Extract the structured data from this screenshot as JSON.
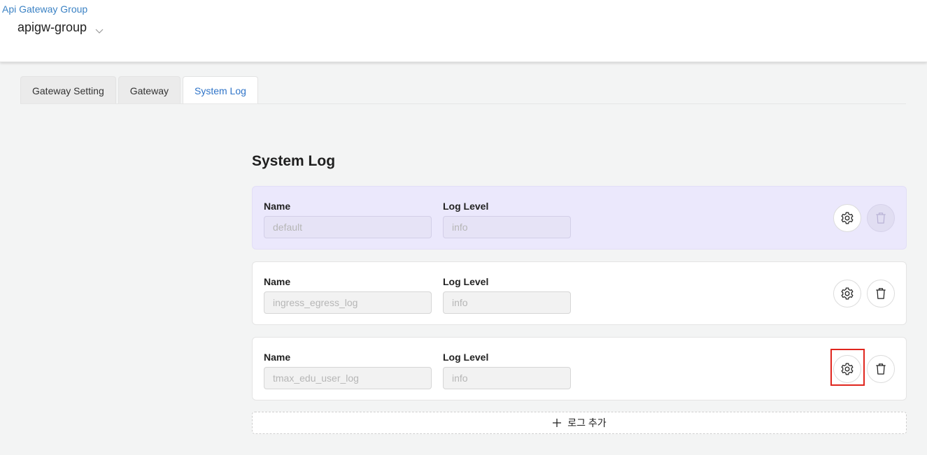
{
  "header": {
    "breadcrumb": "Api Gateway Group",
    "group_name": "apigw-group"
  },
  "tabs": [
    {
      "label": "Gateway Setting",
      "active": false
    },
    {
      "label": "Gateway",
      "active": false
    },
    {
      "label": "System Log",
      "active": true
    }
  ],
  "section": {
    "title": "System Log",
    "name_label": "Name",
    "level_label": "Log Level"
  },
  "logs": [
    {
      "name": "default",
      "level": "info",
      "delete_disabled": true
    },
    {
      "name": "ingress_egress_log",
      "level": "info",
      "delete_disabled": false
    },
    {
      "name": "tmax_edu_user_log",
      "level": "info",
      "delete_disabled": false
    }
  ],
  "add_button": {
    "label": "로그 추가"
  },
  "colors": {
    "accent": "#2f74c8",
    "link": "#3b82c4",
    "highlight_card": "#ebe8fc",
    "focus_outline": "#e0261e"
  },
  "icons": {
    "settings": "gear-icon",
    "delete": "trash-icon",
    "add": "plus-icon",
    "dropdown": "chevron-down-icon"
  }
}
